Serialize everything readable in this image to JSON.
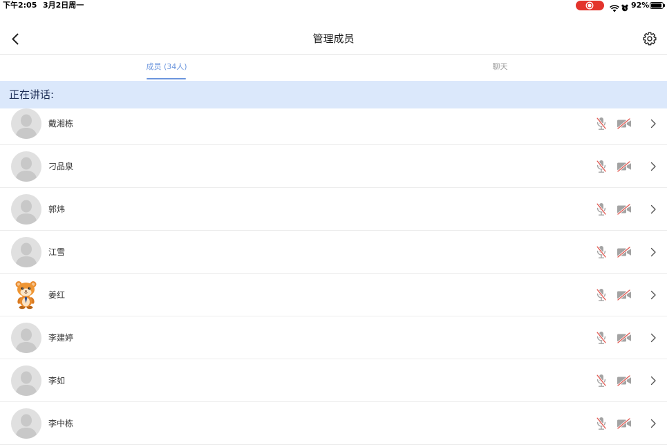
{
  "status_bar": {
    "time": "下午2:05",
    "date": "3月2日周一",
    "battery_percent": "92%",
    "battery_level": 0.92,
    "recording_icon": "screen-recording-icon",
    "wifi_icon": "wifi-icon",
    "alarm_icon": "alarm-icon",
    "battery_icon": "battery-icon"
  },
  "nav": {
    "back_icon": "chevron-left-icon",
    "title": "管理成员",
    "settings_icon": "gear-icon"
  },
  "tabs": [
    {
      "label": "成员 (34人)",
      "active": true
    },
    {
      "label": "聊天",
      "active": false
    }
  ],
  "section": {
    "title": "正在讲话:"
  },
  "members": [
    {
      "name": "戴湘栋",
      "avatar": "default-avatar-icon",
      "mic_icon": "mic-muted-icon",
      "camera_icon": "camera-off-icon"
    },
    {
      "name": "刁品泉",
      "avatar": "default-avatar-icon",
      "mic_icon": "mic-muted-icon",
      "camera_icon": "camera-off-icon"
    },
    {
      "name": "郭炜",
      "avatar": "default-avatar-icon",
      "mic_icon": "mic-muted-icon",
      "camera_icon": "camera-off-icon"
    },
    {
      "name": "江雪",
      "avatar": "default-avatar-icon",
      "mic_icon": "mic-muted-icon",
      "camera_icon": "camera-off-icon"
    },
    {
      "name": "姜红",
      "avatar": "cartoon-avatar-icon",
      "mic_icon": "mic-muted-icon",
      "camera_icon": "camera-off-icon"
    },
    {
      "name": "李建婷",
      "avatar": "default-avatar-icon",
      "mic_icon": "mic-muted-icon",
      "camera_icon": "camera-off-icon"
    },
    {
      "name": "李如",
      "avatar": "default-avatar-icon",
      "mic_icon": "mic-muted-icon",
      "camera_icon": "camera-off-icon"
    },
    {
      "name": "李中栋",
      "avatar": "default-avatar-icon",
      "mic_icon": "mic-muted-icon",
      "camera_icon": "camera-off-icon"
    }
  ],
  "row_chevron_icon": "chevron-right-icon",
  "colors": {
    "accent": "#6b95dd",
    "section_background": "#dbe8fb",
    "muted_red": "#e25c55",
    "recording_red": "#e3342c"
  }
}
